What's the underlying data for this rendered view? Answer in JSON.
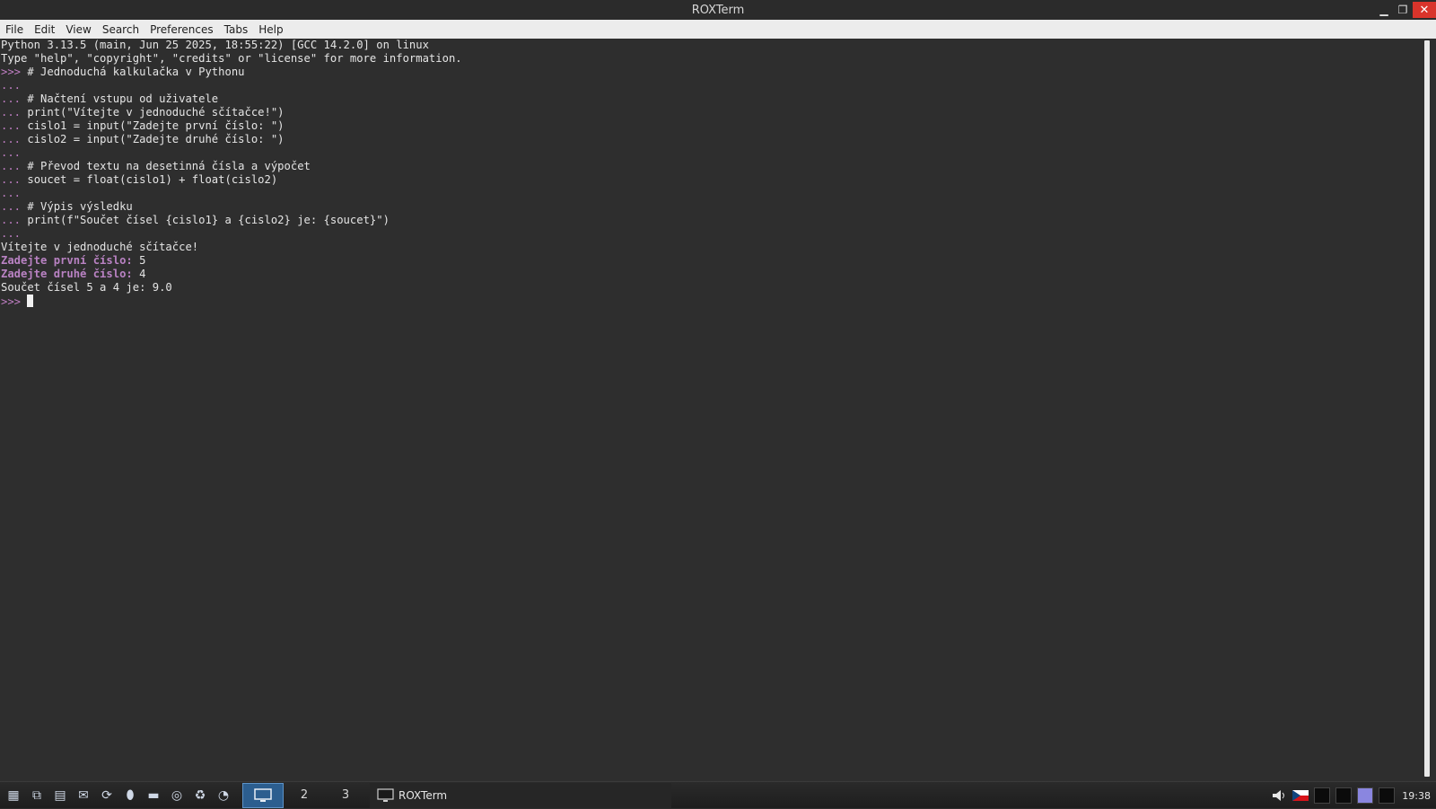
{
  "window": {
    "title": "ROXTerm",
    "controls": {
      "minimize": "▁",
      "maximize": "❐",
      "close": "✕"
    }
  },
  "menubar": {
    "items": [
      "File",
      "Edit",
      "View",
      "Search",
      "Preferences",
      "Tabs",
      "Help"
    ]
  },
  "terminal": {
    "lines": [
      [
        {
          "t": "Python 3.13.5 (main, Jun 25 2025, 18:55:22) [GCC 14.2.0] on linux",
          "c": ""
        }
      ],
      [
        {
          "t": "Type \"help\", \"copyright\", \"credits\" or \"license\" for more information.",
          "c": ""
        }
      ],
      [
        {
          "t": ">>> ",
          "c": "prompt"
        },
        {
          "t": "# Jednoduchá kalkulačka v Pythonu",
          "c": ""
        }
      ],
      [
        {
          "t": "...",
          "c": "prompt"
        }
      ],
      [
        {
          "t": "... ",
          "c": "prompt"
        },
        {
          "t": "# Načtení vstupu od uživatele",
          "c": ""
        }
      ],
      [
        {
          "t": "... ",
          "c": "prompt"
        },
        {
          "t": "print(\"Vítejte v jednoduché sčítačce!\")",
          "c": ""
        }
      ],
      [
        {
          "t": "... ",
          "c": "prompt"
        },
        {
          "t": "cislo1 = input(\"Zadejte první číslo: \")",
          "c": ""
        }
      ],
      [
        {
          "t": "... ",
          "c": "prompt"
        },
        {
          "t": "cislo2 = input(\"Zadejte druhé číslo: \")",
          "c": ""
        }
      ],
      [
        {
          "t": "...",
          "c": "prompt"
        }
      ],
      [
        {
          "t": "... ",
          "c": "prompt"
        },
        {
          "t": "# Převod textu na desetinná čísla a výpočet",
          "c": ""
        }
      ],
      [
        {
          "t": "... ",
          "c": "prompt"
        },
        {
          "t": "soucet = float(cislo1) + float(cislo2)",
          "c": ""
        }
      ],
      [
        {
          "t": "...",
          "c": "prompt"
        }
      ],
      [
        {
          "t": "... ",
          "c": "prompt"
        },
        {
          "t": "# Výpis výsledku",
          "c": ""
        }
      ],
      [
        {
          "t": "... ",
          "c": "prompt"
        },
        {
          "t": "print(f\"Součet čísel {cislo1} a {cislo2} je: {soucet}\")",
          "c": ""
        }
      ],
      [
        {
          "t": "...",
          "c": "prompt"
        }
      ],
      [
        {
          "t": "Vítejte v jednoduché sčítačce!",
          "c": ""
        }
      ],
      [
        {
          "t": "Zadejte první číslo:",
          "c": "magenta-bold"
        },
        {
          "t": " 5",
          "c": ""
        }
      ],
      [
        {
          "t": "Zadejte druhé číslo:",
          "c": "magenta-bold"
        },
        {
          "t": " 4",
          "c": ""
        }
      ],
      [
        {
          "t": "Součet čísel 5 a 4 je: 9.0",
          "c": ""
        }
      ],
      [
        {
          "t": ">>> ",
          "c": "prompt"
        },
        {
          "t": "",
          "c": "cursor"
        }
      ]
    ]
  },
  "taskbar": {
    "launchers": [
      {
        "name": "app-menu-icon",
        "glyph": "▦"
      },
      {
        "name": "windows-icon",
        "glyph": "⧉"
      },
      {
        "name": "workspace-switch-icon",
        "glyph": "▤"
      },
      {
        "name": "mail-icon",
        "glyph": "✉"
      },
      {
        "name": "update-icon",
        "glyph": "⟳"
      },
      {
        "name": "mouse-icon",
        "glyph": "⬮"
      },
      {
        "name": "folder-icon",
        "glyph": "▬"
      },
      {
        "name": "browser-icon",
        "glyph": "◎"
      },
      {
        "name": "recycle-icon",
        "glyph": "♻"
      },
      {
        "name": "clock-app-icon",
        "glyph": "◔"
      }
    ],
    "workspaces": [
      "",
      "2",
      "3"
    ],
    "task": {
      "label": "ROXTerm"
    },
    "clock": "19:38"
  }
}
